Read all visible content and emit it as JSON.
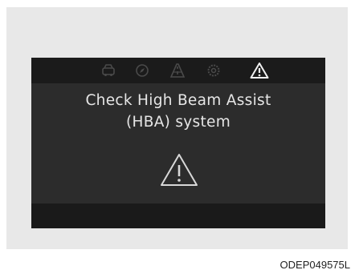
{
  "display": {
    "top_icons": [
      "car-icon",
      "compass-icon",
      "lane-icon",
      "gear-icon",
      "warning-icon"
    ],
    "message_line1": "Check High Beam Assist",
    "message_line2": "(HBA) system",
    "center_icon": "warning-icon"
  },
  "figure_code": "ODEP049575L",
  "colors": {
    "frame": "#e8e8e8",
    "screen": "#2b2b2b",
    "bars": "#1b1b1b",
    "text": "#e6e6e6",
    "active_icon": "#f2f2f2",
    "inactive_icon": "#4a4a4a"
  }
}
